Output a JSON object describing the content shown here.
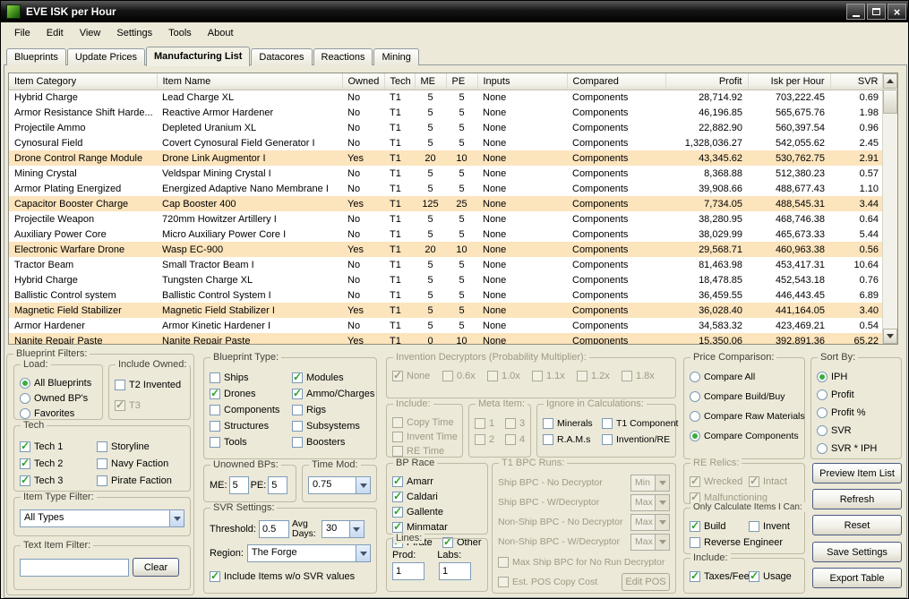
{
  "colors": {
    "panel": "#ECE9D8",
    "owned-row": "#FCE4BC",
    "check-green": "#27A427",
    "radio-green": "#3BAE3B",
    "disabled-text": "#9D9A84"
  },
  "window": {
    "title": "EVE ISK per Hour"
  },
  "menu": {
    "items": [
      "File",
      "Edit",
      "View",
      "Settings",
      "Tools",
      "About"
    ]
  },
  "tabs": {
    "items": [
      {
        "label": "Blueprints",
        "active": false
      },
      {
        "label": "Update Prices",
        "active": false
      },
      {
        "label": "Manufacturing List",
        "active": true
      },
      {
        "label": "Datacores",
        "active": false
      },
      {
        "label": "Reactions",
        "active": false
      },
      {
        "label": "Mining",
        "active": false
      }
    ]
  },
  "grid": {
    "columns": [
      "Item Category",
      "Item Name",
      "Owned",
      "Tech",
      "ME",
      "PE",
      "Inputs",
      "Compared",
      "Profit",
      "Isk per Hour",
      "SVR"
    ],
    "rows": [
      [
        "Hybrid Charge",
        "Lead Charge XL",
        "No",
        "T1",
        "5",
        "5",
        "None",
        "Components",
        "28,714.92",
        "703,222.45",
        "0.69"
      ],
      [
        "Armor Resistance Shift Harde...",
        "Reactive Armor Hardener",
        "No",
        "T1",
        "5",
        "5",
        "None",
        "Components",
        "46,196.85",
        "565,675.76",
        "1.98"
      ],
      [
        "Projectile Ammo",
        "Depleted Uranium XL",
        "No",
        "T1",
        "5",
        "5",
        "None",
        "Components",
        "22,882.90",
        "560,397.54",
        "0.96"
      ],
      [
        "Cynosural Field",
        "Covert Cynosural Field Generator I",
        "No",
        "T1",
        "5",
        "5",
        "None",
        "Components",
        "1,328,036.27",
        "542,055.62",
        "2.45"
      ],
      [
        "Drone Control Range Module",
        "Drone Link Augmentor I",
        "Yes",
        "T1",
        "20",
        "10",
        "None",
        "Components",
        "43,345.62",
        "530,762.75",
        "2.91"
      ],
      [
        "Mining Crystal",
        "Veldspar Mining Crystal I",
        "No",
        "T1",
        "5",
        "5",
        "None",
        "Components",
        "8,368.88",
        "512,380.23",
        "0.57"
      ],
      [
        "Armor Plating Energized",
        "Energized Adaptive Nano Membrane I",
        "No",
        "T1",
        "5",
        "5",
        "None",
        "Components",
        "39,908.66",
        "488,677.43",
        "1.10"
      ],
      [
        "Capacitor Booster Charge",
        "Cap Booster 400",
        "Yes",
        "T1",
        "125",
        "25",
        "None",
        "Components",
        "7,734.05",
        "488,545.31",
        "3.44"
      ],
      [
        "Projectile Weapon",
        "720mm Howitzer Artillery I",
        "No",
        "T1",
        "5",
        "5",
        "None",
        "Components",
        "38,280.95",
        "468,746.38",
        "0.64"
      ],
      [
        "Auxiliary Power Core",
        "Micro Auxiliary Power Core I",
        "No",
        "T1",
        "5",
        "5",
        "None",
        "Components",
        "38,029.99",
        "465,673.33",
        "5.44"
      ],
      [
        "Electronic Warfare Drone",
        "Wasp EC-900",
        "Yes",
        "T1",
        "20",
        "10",
        "None",
        "Components",
        "29,568.71",
        "460,963.38",
        "0.56"
      ],
      [
        "Tractor Beam",
        "Small Tractor Beam I",
        "No",
        "T1",
        "5",
        "5",
        "None",
        "Components",
        "81,463.98",
        "453,417.31",
        "10.64"
      ],
      [
        "Hybrid Charge",
        "Tungsten Charge XL",
        "No",
        "T1",
        "5",
        "5",
        "None",
        "Components",
        "18,478.85",
        "452,543.18",
        "0.76"
      ],
      [
        "Ballistic Control system",
        "Ballistic Control System I",
        "No",
        "T1",
        "5",
        "5",
        "None",
        "Components",
        "36,459.55",
        "446,443.45",
        "6.89"
      ],
      [
        "Magnetic Field Stabilizer",
        "Magnetic Field Stabilizer I",
        "Yes",
        "T1",
        "5",
        "5",
        "None",
        "Components",
        "36,028.40",
        "441,164.05",
        "3.40"
      ],
      [
        "Armor Hardener",
        "Armor Kinetic Hardener I",
        "No",
        "T1",
        "5",
        "5",
        "None",
        "Components",
        "34,583.32",
        "423,469.21",
        "0.54"
      ],
      [
        "Nanite Repair Paste",
        "Nanite Repair Paste",
        "Yes",
        "T1",
        "0",
        "10",
        "None",
        "Components",
        "15,350.06",
        "392,891.36",
        "65.22"
      ]
    ]
  },
  "filters": {
    "blueprint_filters": {
      "title": "Blueprint Filters:"
    },
    "load": {
      "title": "Load:",
      "options": [
        {
          "label": "All Blueprints",
          "selected": true
        },
        {
          "label": "Owned BP's",
          "selected": false
        },
        {
          "label": "Favorites",
          "selected": false
        }
      ]
    },
    "include_owned": {
      "title": "Include Owned:",
      "items": [
        {
          "label": "T2 Invented",
          "checked": false
        },
        {
          "label": "T3",
          "checked": true,
          "disabled": true
        }
      ]
    },
    "tech": {
      "title": "Tech",
      "items": [
        {
          "label": "Tech 1",
          "checked": true
        },
        {
          "label": "Tech 2",
          "checked": true
        },
        {
          "label": "Tech 3",
          "checked": true
        },
        {
          "label": "Storyline",
          "checked": false
        },
        {
          "label": "Navy Faction",
          "checked": false
        },
        {
          "label": "Pirate Faction",
          "checked": false
        }
      ]
    },
    "item_type_filter": {
      "title": "Item Type Filter:",
      "value": "All Types"
    },
    "text_item_filter": {
      "title": "Text Item Filter:",
      "value": "",
      "clear_label": "Clear"
    },
    "blueprint_type": {
      "title": "Blueprint Type:",
      "items": [
        {
          "label": "Ships",
          "checked": false
        },
        {
          "label": "Drones",
          "checked": true
        },
        {
          "label": "Components",
          "checked": false
        },
        {
          "label": "Structures",
          "checked": false
        },
        {
          "label": "Tools",
          "checked": false
        },
        {
          "label": "Modules",
          "checked": true
        },
        {
          "label": "Ammo/Charges",
          "checked": true
        },
        {
          "label": "Rigs",
          "checked": false
        },
        {
          "label": "Subsystems",
          "checked": false
        },
        {
          "label": "Boosters",
          "checked": false
        }
      ]
    },
    "unowned_bps": {
      "title": "Unowned BPs:",
      "me_label": "ME:",
      "me": "5",
      "pe_label": "PE:",
      "pe": "5"
    },
    "time_mod": {
      "title": "Time Mod:",
      "value": "0.75"
    },
    "svr_settings": {
      "title": "SVR Settings:",
      "threshold_label": "Threshold:",
      "threshold": "0.5",
      "avg_days_label": "Avg Days:",
      "avg_days": "30",
      "region_label": "Region:",
      "region": "The Forge",
      "include_wo": {
        "label": "Include Items w/o SVR values",
        "checked": true
      }
    },
    "invention_decryptors": {
      "title": "Invention Decryptors (Probability Multiplier):",
      "items": [
        {
          "label": "None",
          "checked": true,
          "disabled": true
        },
        {
          "label": "0.6x",
          "checked": false,
          "disabled": true
        },
        {
          "label": "1.0x",
          "checked": false,
          "disabled": true
        },
        {
          "label": "1.1x",
          "checked": false,
          "disabled": true
        },
        {
          "label": "1.2x",
          "checked": false,
          "disabled": true
        },
        {
          "label": "1.8x",
          "checked": false,
          "disabled": true
        }
      ]
    },
    "include_time": {
      "title": "Include:",
      "items": [
        {
          "label": "Copy Time",
          "checked": false,
          "disabled": true
        },
        {
          "label": "Invent Time",
          "checked": false,
          "disabled": true
        },
        {
          "label": "RE Time",
          "checked": false,
          "disabled": true
        }
      ]
    },
    "meta_item": {
      "title": "Meta Item:",
      "items": [
        {
          "label": "1",
          "checked": false,
          "disabled": true
        },
        {
          "label": "3",
          "checked": false,
          "disabled": true
        },
        {
          "label": "2",
          "checked": false,
          "disabled": true
        },
        {
          "label": "4",
          "checked": false,
          "disabled": true
        }
      ]
    },
    "ignore_calc": {
      "title": "Ignore in Calculations:",
      "items": [
        {
          "label": "Minerals",
          "checked": false
        },
        {
          "label": "T1 Component",
          "checked": false
        },
        {
          "label": "R.A.M.s",
          "checked": false
        },
        {
          "label": "Invention/RE",
          "checked": false
        }
      ]
    },
    "bp_race": {
      "title": "BP Race",
      "items": [
        {
          "label": "Amarr",
          "checked": true
        },
        {
          "label": "Caldari",
          "checked": true
        },
        {
          "label": "Gallente",
          "checked": true
        },
        {
          "label": "Minmatar",
          "checked": true
        },
        {
          "label": "Pirate",
          "checked": true
        },
        {
          "label": "Other",
          "checked": true
        }
      ]
    },
    "lines": {
      "title": "Lines:",
      "prod_label": "Prod:",
      "prod": "1",
      "labs_label": "Labs:",
      "labs": "1"
    },
    "t1_bpc": {
      "title": "T1 BPC Runs:",
      "rows": [
        {
          "label": "Ship BPC - No Decryptor",
          "value": "Min"
        },
        {
          "label": "Ship BPC - W/Decryptor",
          "value": "Max"
        },
        {
          "label": "Non-Ship BPC - No Decryptor",
          "value": "Max"
        },
        {
          "label": "Non-Ship BPC - W/Decryptor",
          "value": "Max"
        }
      ],
      "max_ship": {
        "label": "Max Ship BPC for No Run Decryptor",
        "checked": false
      },
      "est_pos": {
        "label": "Est. POS Copy Cost",
        "checked": false
      },
      "edit_pos_label": "Edit POS"
    },
    "price_comparison": {
      "title": "Price Comparison:",
      "options": [
        {
          "label": "Compare All",
          "selected": false
        },
        {
          "label": "Compare Build/Buy",
          "selected": false
        },
        {
          "label": "Compare Raw Materials",
          "selected": false
        },
        {
          "label": "Compare Components",
          "selected": true
        }
      ]
    },
    "sort_by": {
      "title": "Sort By:",
      "options": [
        {
          "label": "IPH",
          "selected": true
        },
        {
          "label": "Profit",
          "selected": false
        },
        {
          "label": "Profit %",
          "selected": false
        },
        {
          "label": "SVR",
          "selected": false
        },
        {
          "label": "SVR * IPH",
          "selected": false
        }
      ]
    },
    "re_relics": {
      "title": "RE Relics:",
      "items": [
        {
          "label": "Wrecked",
          "checked": true,
          "disabled": true
        },
        {
          "label": "Intact",
          "checked": true,
          "disabled": true
        },
        {
          "label": "Malfunctioning",
          "checked": true,
          "disabled": true
        }
      ]
    },
    "only_calc": {
      "title": "Only Calculate Items I Can:",
      "items": [
        {
          "label": "Build",
          "checked": true
        },
        {
          "label": "Invent",
          "checked": false
        },
        {
          "label": "Reverse Engineer",
          "checked": false
        }
      ]
    },
    "include_fees": {
      "title": "Include:",
      "items": [
        {
          "label": "Taxes/Fees",
          "checked": true
        },
        {
          "label": "Usage",
          "checked": true
        }
      ]
    }
  },
  "actions": [
    "Preview Item List",
    "Refresh",
    "Reset",
    "Save Settings",
    "Export Table"
  ]
}
